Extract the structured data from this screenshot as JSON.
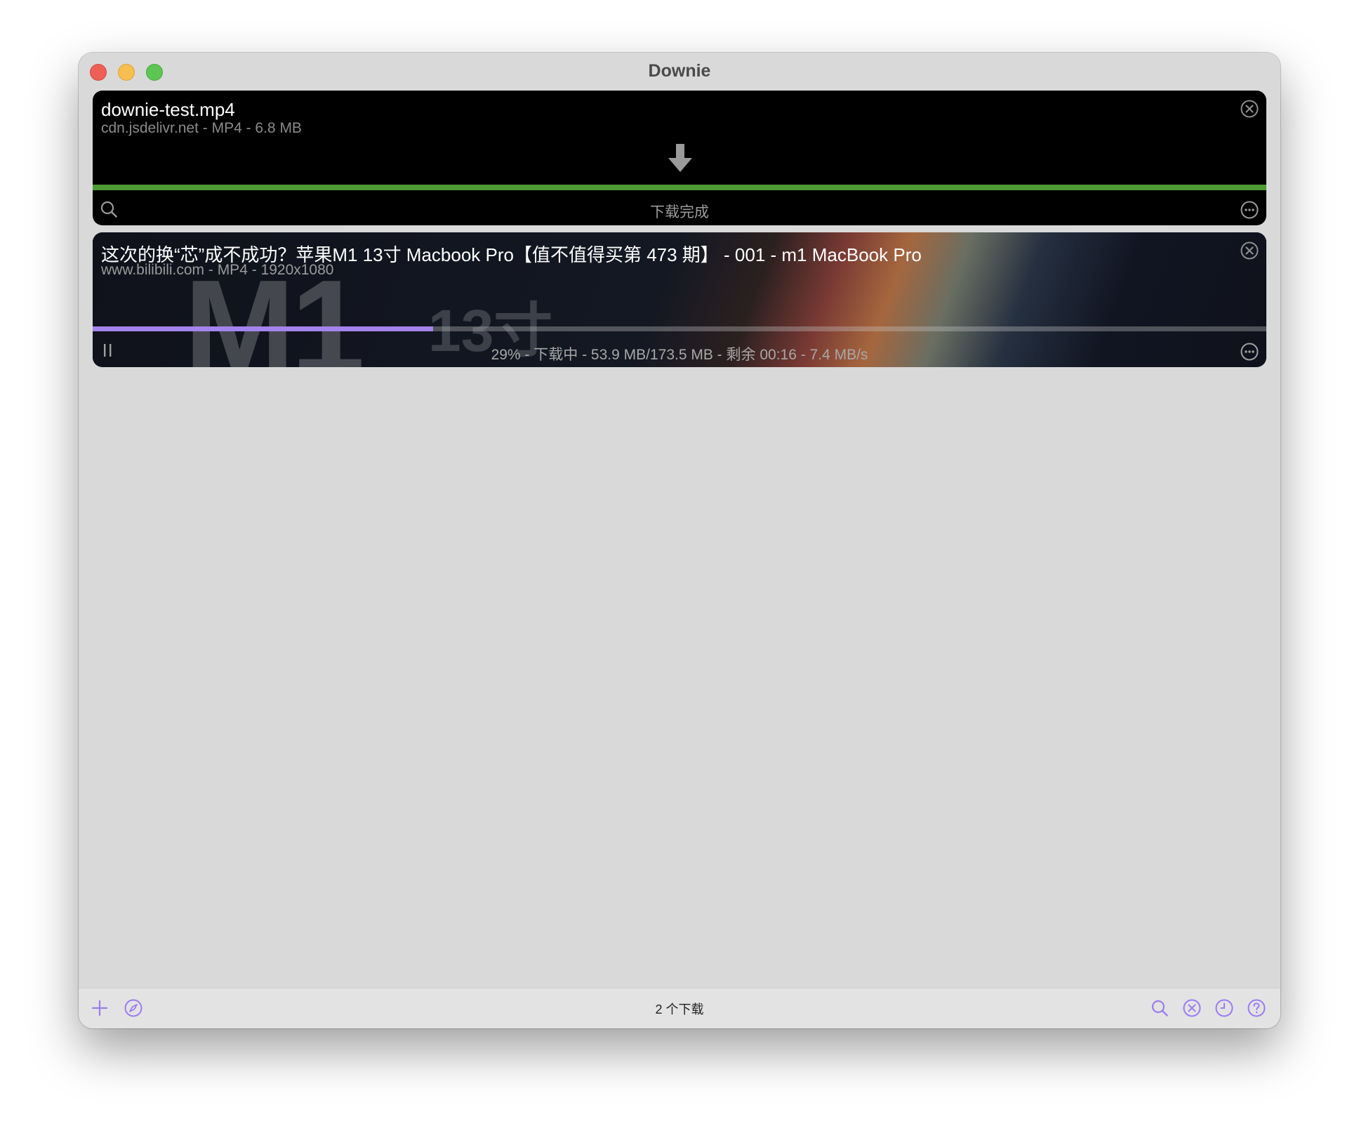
{
  "window": {
    "title": "Downie"
  },
  "downloads": [
    {
      "name": "downie-test.mp4",
      "meta": "cdn.jsdelivr.net - MP4 - 6.8 MB",
      "status": "下载完成",
      "progress": 1.0,
      "progress_color": "#4e9b34"
    },
    {
      "name": "这次的换“芯”成不成功？苹果M1 13寸 Macbook Pro【值不值得买第 473 期】 - 001 - m1 MacBook Pro",
      "meta": "www.bilibili.com - MP4 - 1920x1080",
      "status": "29% - 下载中 - 53.9 MB/173.5 MB - 剩余 00:16 - 7.4 MB/s",
      "progress": 0.29,
      "progress_color": "#a583ec",
      "thumbnail_text_1": "M1",
      "thumbnail_text_2": "13寸"
    }
  ],
  "footer": {
    "count_label": "2 个下载",
    "accent_color": "#9b7cf0",
    "left_icons": [
      "plus-icon",
      "compass-icon"
    ],
    "right_icons": [
      "search-icon",
      "close-circle-icon",
      "clock-icon",
      "help-icon"
    ]
  }
}
